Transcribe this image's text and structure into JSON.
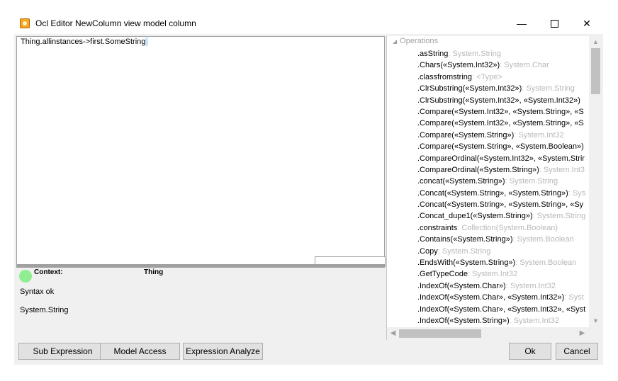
{
  "window": {
    "title": "Ocl Editor NewColumn view model column",
    "minimize_glyph": "—",
    "close_glyph": "✕"
  },
  "editor": {
    "expression": "Thing.allinstances->first.SomeString"
  },
  "status": {
    "context_label": "Context:",
    "context_value": "Thing",
    "syntax_message": "Syntax ok",
    "result_type": "System.String",
    "indicator_color": "#90ee90"
  },
  "tree": {
    "root_label": "Operations",
    "items": [
      {
        "name": ".asString",
        "type": ": System.String"
      },
      {
        "name": ".Chars(«System.Int32»)",
        "type": ": System.Char"
      },
      {
        "name": ".classfromstring",
        "type": ": <Type>"
      },
      {
        "name": ".ClrSubstring(«System.Int32»)",
        "type": ": System.String"
      },
      {
        "name": ".ClrSubstring(«System.Int32», «System.Int32»)",
        "type": ""
      },
      {
        "name": ".Compare(«System.Int32», «System.String», «S",
        "type": ""
      },
      {
        "name": ".Compare(«System.Int32», «System.String», «S",
        "type": ""
      },
      {
        "name": ".Compare(«System.String»)",
        "type": ": System.Int32"
      },
      {
        "name": ".Compare(«System.String», «System.Boolean»)",
        "type": ""
      },
      {
        "name": ".CompareOrdinal(«System.Int32», «System.Strir",
        "type": ""
      },
      {
        "name": ".CompareOrdinal(«System.String»)",
        "type": ": System.Int3"
      },
      {
        "name": ".concat(«System.String»)",
        "type": ": System.String"
      },
      {
        "name": ".Concat(«System.String», «System.String»)",
        "type": ": Sys"
      },
      {
        "name": ".Concat(«System.String», «System.String», «Sy",
        "type": ""
      },
      {
        "name": ".Concat_dupe1(«System.String»)",
        "type": ": System.String"
      },
      {
        "name": ".constraints",
        "type": ": Collection(System.Boolean)"
      },
      {
        "name": ".Contains(«System.String»)",
        "type": ": System.Boolean"
      },
      {
        "name": ".Copy",
        "type": ": System.String"
      },
      {
        "name": ".EndsWith(«System.String»)",
        "type": ": System.Boolean"
      },
      {
        "name": ".GetTypeCode",
        "type": ": System.Int32"
      },
      {
        "name": ".IndexOf(«System.Char»)",
        "type": ": System.Int32"
      },
      {
        "name": ".IndexOf(«System.Char», «System.Int32»)",
        "type": ": Syst"
      },
      {
        "name": ".IndexOf(«System.Char», «System.Int32», «Syst",
        "type": ""
      },
      {
        "name": ".IndexOf(«System.String»)",
        "type": ": System.Int32"
      }
    ]
  },
  "buttons": {
    "sub_expression": "Sub Expression",
    "model_access": "Model Access",
    "expression_analyze": "Expression Analyze",
    "ok": "Ok",
    "cancel": "Cancel"
  }
}
